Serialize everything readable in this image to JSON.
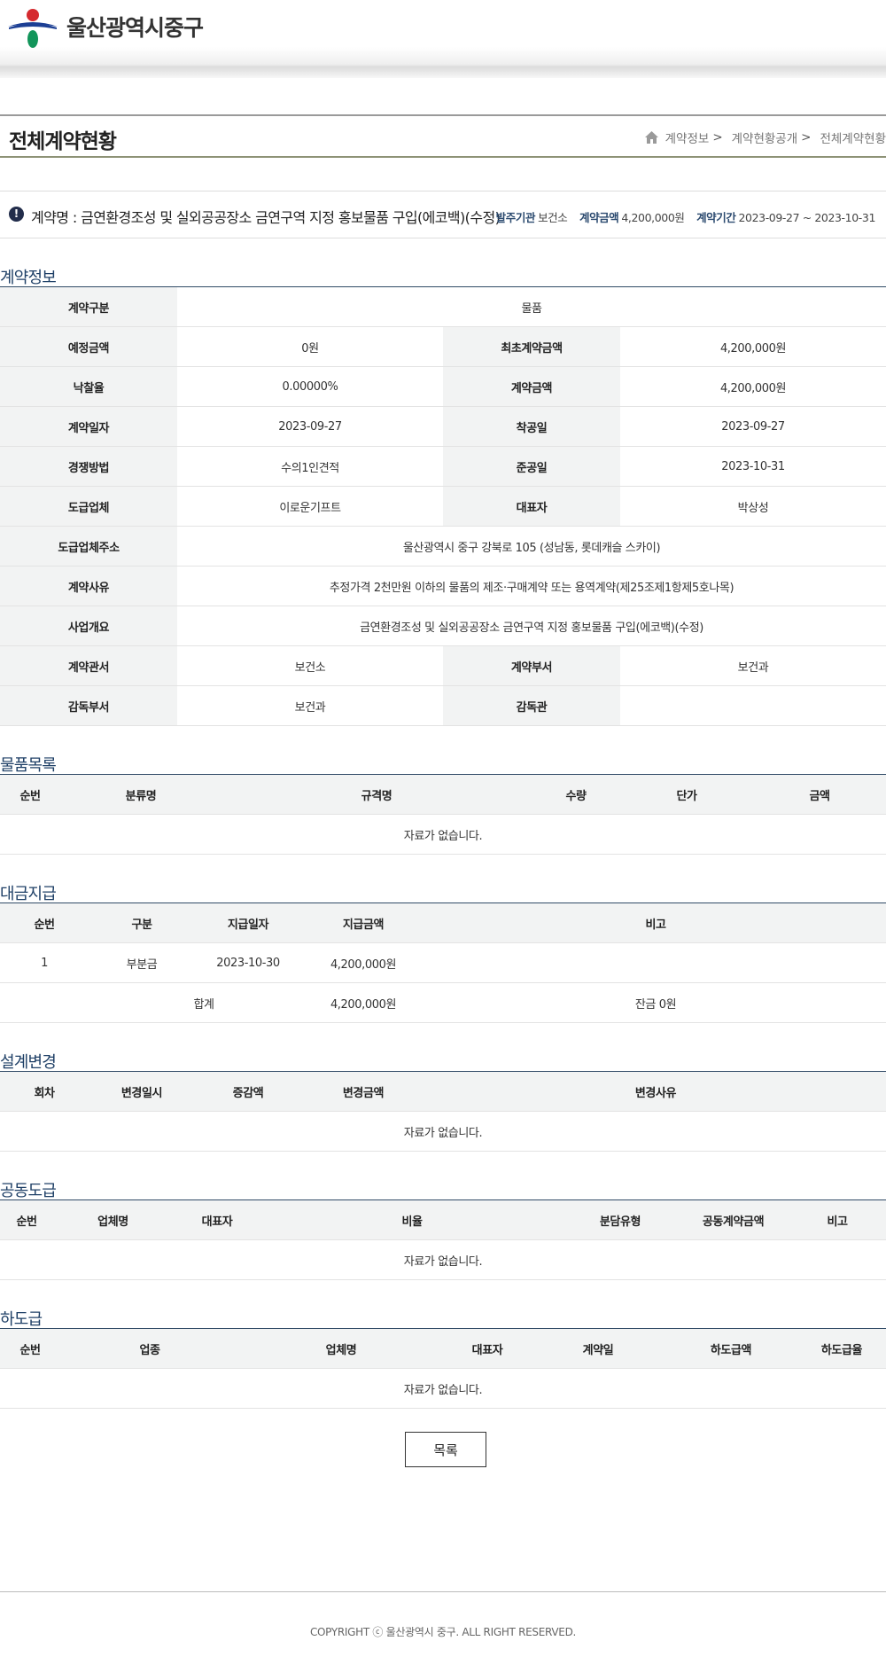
{
  "header": {
    "brand": "울산광역시중구"
  },
  "title_bar": {
    "page_title": "전체계약현황",
    "breadcrumb": [
      "계약정보",
      "계약현황공개",
      "전체계약현황"
    ],
    "separator": ">"
  },
  "summary": {
    "contract_name": "계약명 : 금연환경조성 및 실외공공장소 금연구역 지정 홍보물품 구입(에코백)(수정)",
    "agency_label": "발주기관",
    "agency": "보건소",
    "amount_label": "계약금액",
    "amount": "4,200,000원",
    "period_label": "계약기간",
    "period": "2023-09-27 ~ 2023-10-31"
  },
  "contract_info": {
    "title": "계약정보",
    "rows": [
      {
        "k1": "계약구분",
        "v1": "물품"
      },
      {
        "k1": "예정금액",
        "v1": "0원",
        "k2": "최초계약금액",
        "v2": "4,200,000원"
      },
      {
        "k1": "낙찰율",
        "v1": "0.00000%",
        "k2": "계약금액",
        "v2": "4,200,000원"
      },
      {
        "k1": "계약일자",
        "v1": "2023-09-27",
        "k2": "착공일",
        "v2": "2023-09-27"
      },
      {
        "k1": "경쟁방법",
        "v1": "수의1인견적",
        "k2": "준공일",
        "v2": "2023-10-31"
      },
      {
        "k1": "도급업체",
        "v1": "이로운기프트",
        "k2": "대표자",
        "v2": "박상성"
      },
      {
        "k1": "도급업체주소",
        "v1": "울산광역시 중구 강북로 105 (성남동, 롯데캐슬 스카이)"
      },
      {
        "k1": "계약사유",
        "v1": "추정가격 2천만원 이하의 물품의 제조·구매계약 또는 용역계약(제25조제1항제5호나목)"
      },
      {
        "k1": "사업개요",
        "v1": "금연환경조성 및 실외공공장소 금연구역 지정 홍보물품 구입(에코백)(수정)"
      },
      {
        "k1": "계약관서",
        "v1": "보건소",
        "k2": "계약부서",
        "v2": "보건과"
      },
      {
        "k1": "감독부서",
        "v1": "보건과",
        "k2": "감독관",
        "v2": ""
      }
    ]
  },
  "goods": {
    "title": "물품목록",
    "headers": [
      "순번",
      "분류명",
      "규격명",
      "수량",
      "단가",
      "금액"
    ],
    "empty": "자료가 없습니다."
  },
  "payment": {
    "title": "대금지급",
    "headers": [
      "순번",
      "구분",
      "지급일자",
      "지급금액",
      "비고"
    ],
    "rows": [
      [
        "1",
        "부분금",
        "2023-10-30",
        "4,200,000원",
        ""
      ]
    ],
    "total": {
      "label": "합계",
      "amount": "4,200,000원",
      "remark": "잔금 0원"
    }
  },
  "design_change": {
    "title": "설계변경",
    "headers": [
      "회차",
      "변경일시",
      "증감액",
      "변경금액",
      "변경사유"
    ],
    "empty": "자료가 없습니다."
  },
  "joint": {
    "title": "공동도급",
    "headers": [
      "순번",
      "업체명",
      "대표자",
      "비율",
      "분담유형",
      "공동계약금액",
      "비고"
    ],
    "empty": "자료가 없습니다."
  },
  "sub": {
    "title": "하도급",
    "headers": [
      "순번",
      "업종",
      "업체명",
      "대표자",
      "계약일",
      "하도급액",
      "하도급율"
    ],
    "empty": "자료가 없습니다."
  },
  "list_button": "목록",
  "footer": {
    "copyright": "COPYRIGHT ⓒ 울산광역시 중구. ALL RIGHT RESERVED."
  }
}
